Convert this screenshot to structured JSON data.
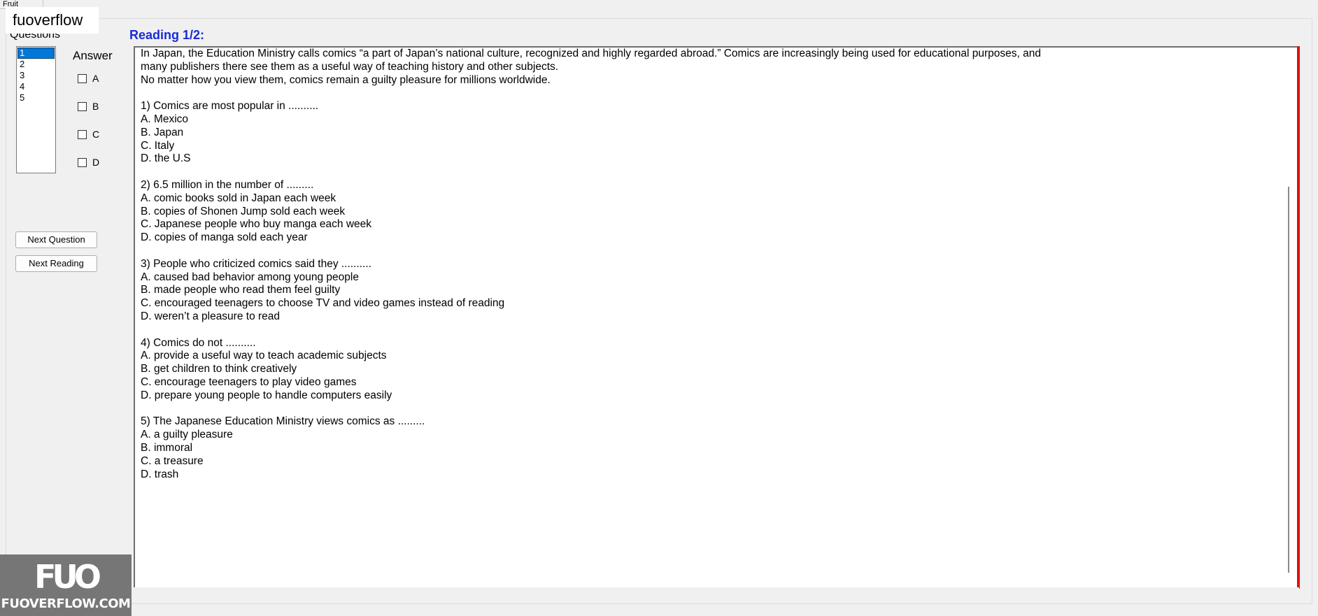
{
  "window": {
    "tab_stub": "Fruit"
  },
  "watermark": {
    "text": "fuoverflow",
    "logo_mark": "FUO",
    "logo_text": "FUOVERFLOW.COM"
  },
  "questions": {
    "label": "Questions",
    "items": [
      "1",
      "2",
      "3",
      "4",
      "5"
    ],
    "selected": "1"
  },
  "answer": {
    "label": "Answer",
    "options": [
      "A",
      "B",
      "C",
      "D"
    ]
  },
  "buttons": {
    "next_question": "Next Question",
    "next_reading": "Next Reading"
  },
  "reading": {
    "title": "Reading 1/2:",
    "lines": [
      "In Japan, the Education Ministry calls comics “a part of Japan’s national culture, recognized and highly regarded abroad.” Comics are increasingly being used for educational purposes, and",
      "many publishers there see them as a useful way of teaching history and other subjects.",
      "No matter how you view them, comics remain a guilty pleasure for millions worldwide.",
      "",
      "1) Comics are most popular in ..........",
      "A.  Mexico",
      "B.  Japan",
      "C.  Italy",
      "D.  the U.S",
      "",
      "2) 6.5 million in the number of .........",
      "A.  comic books sold in Japan each week",
      "B.  copies of Shonen Jump sold each week",
      "C.  Japanese people who buy manga each week",
      "D.  copies of manga sold each year",
      "",
      "3) People who criticized comics said they ..........",
      "A.  caused bad behavior among young people",
      "B.  made people who read them feel guilty",
      "C.  encouraged teenagers to choose TV and video games instead of reading",
      "D.  weren’t a pleasure to read",
      "",
      "4) Comics do not ..........",
      "A.  provide a useful way to teach academic subjects",
      "B.  get children to think creatively",
      "C.  encourage teenagers to play video games",
      "D.  prepare young people to handle computers easily",
      "",
      "5) The Japanese Education Ministry views comics as .........",
      "A.  a guilty pleasure",
      "B.  immoral",
      "C.  a treasure",
      "D.  trash"
    ]
  },
  "colors": {
    "reading_title": "#1a2bd6",
    "selection": "#0078d7",
    "accent_line": "#e01010"
  }
}
